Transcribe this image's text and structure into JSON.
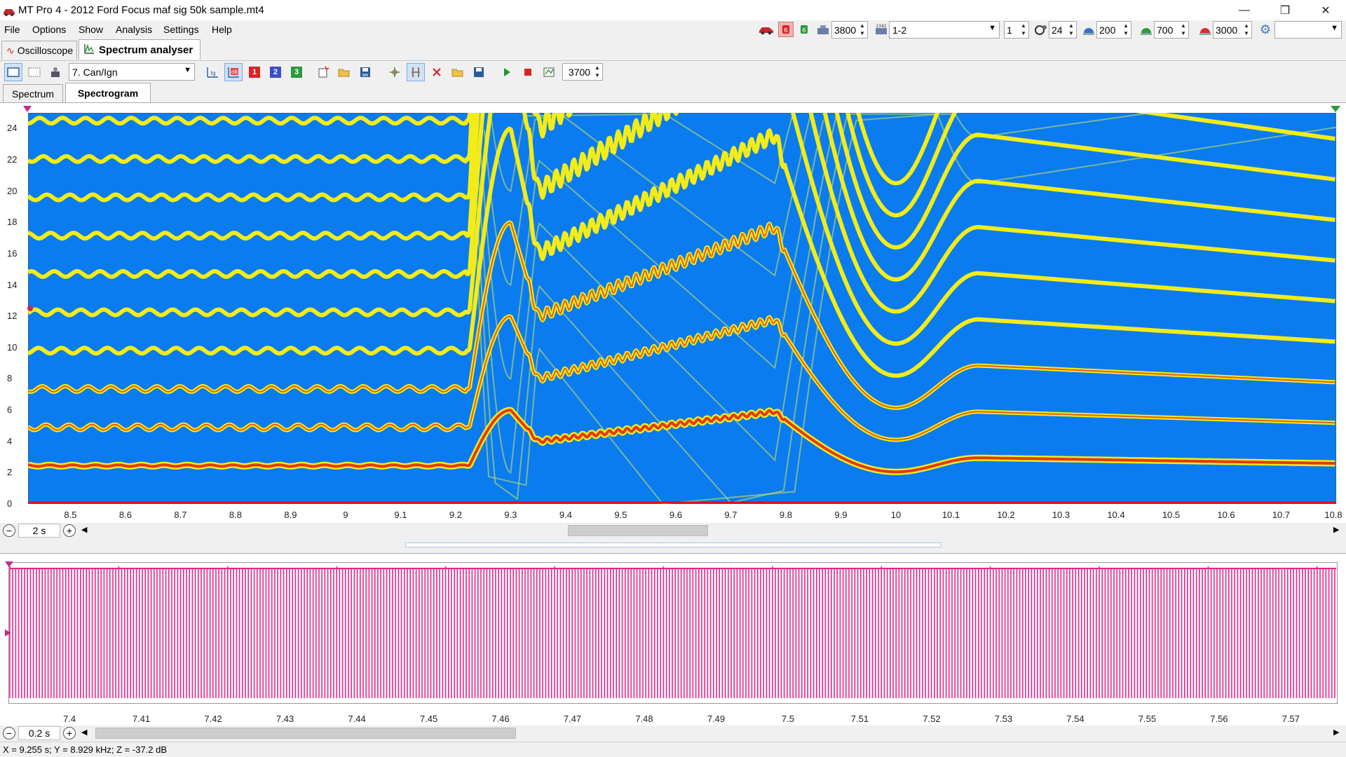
{
  "window": {
    "title": "MT Pro 4 - 2012 Ford Focus maf sig 50k sample.mt4",
    "minimize": "—",
    "restore": "❐",
    "close": "✕"
  },
  "menu": [
    "File",
    "Options",
    "Show",
    "Analysis",
    "Settings",
    "Help"
  ],
  "controls": {
    "rpm_value": "3800",
    "firing_order": "1-2",
    "cyl_count": "1",
    "teeth_value": "24",
    "value_200": "200",
    "value_700": "700",
    "value_3000": "3000",
    "last_combo": ""
  },
  "main_tabs": [
    {
      "label": "Oscilloscope",
      "active": false
    },
    {
      "label": "Spectrum analyser",
      "active": true
    }
  ],
  "toolbar": {
    "channel_select": "7. Can/Ign",
    "fft_size": "3700",
    "btn_db": "dB",
    "btn_1": "1",
    "btn_2": "2",
    "btn_3": "3"
  },
  "sub_tabs": [
    {
      "label": "Spectrum",
      "active": false
    },
    {
      "label": "Spectrogram",
      "active": true
    }
  ],
  "spectrogram": {
    "y_ticks": [
      "24",
      "22",
      "20",
      "18",
      "16",
      "14",
      "12",
      "10",
      "8",
      "6",
      "4",
      "2",
      "0"
    ],
    "x_ticks": [
      "8.5",
      "8.6",
      "8.7",
      "8.8",
      "8.9",
      "9",
      "9.1",
      "9.2",
      "9.3",
      "9.4",
      "9.5",
      "9.6",
      "9.7",
      "9.8",
      "9.9",
      "10",
      "10.1",
      "10.2",
      "10.3",
      "10.4",
      "10.5",
      "10.6",
      "10.7",
      "10.8"
    ],
    "time_span": "2 s",
    "colors": {
      "background": "#0a7cef",
      "line_outer": "#f3ec18",
      "line_hot": "#e43a10",
      "baseline": "#e0101a"
    }
  },
  "scope": {
    "x_ticks": [
      "7.4",
      "7.41",
      "7.42",
      "7.43",
      "7.44",
      "7.45",
      "7.46",
      "7.47",
      "7.48",
      "7.49",
      "7.5",
      "7.51",
      "7.52",
      "7.53",
      "7.54",
      "7.55",
      "7.56",
      "7.57"
    ],
    "time_span": "0.2 s",
    "trace_color": "#e8258a"
  },
  "status": "X = 9.255 s; Y = 8.929 kHz; Z = -37.2 dB"
}
